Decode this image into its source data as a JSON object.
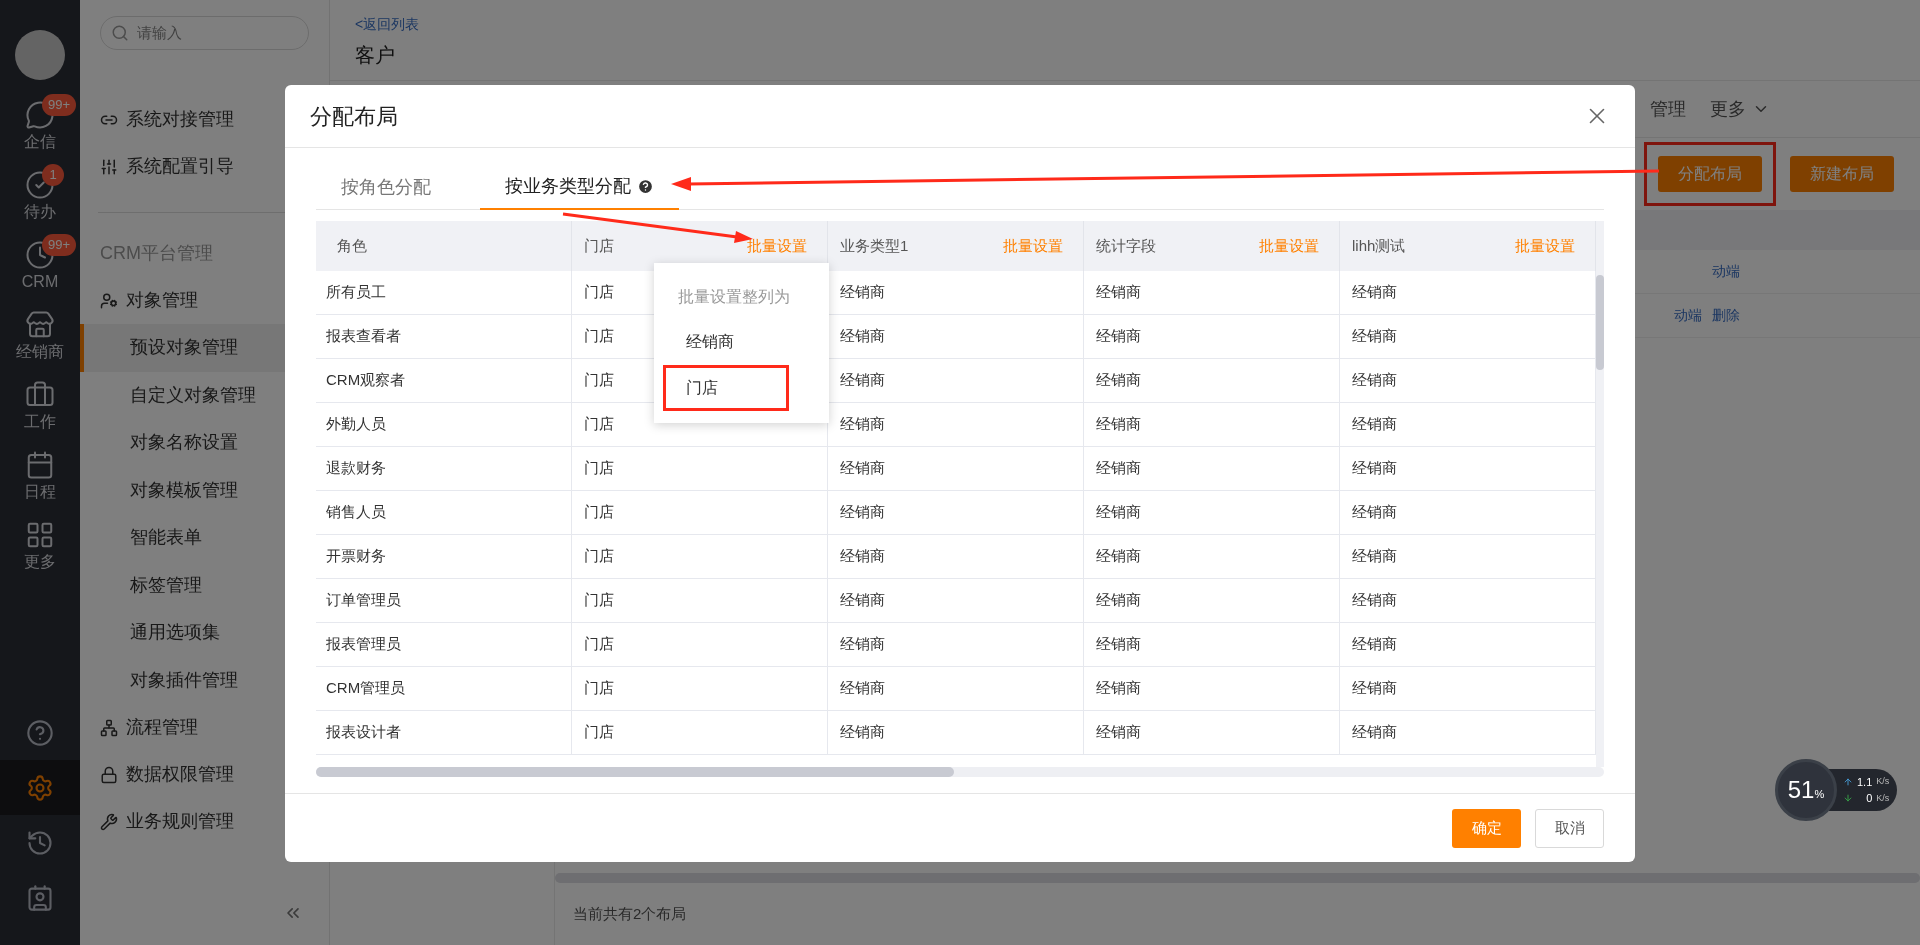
{
  "rail": {
    "items": [
      {
        "label": "企信",
        "badge": "99+"
      },
      {
        "label": "待办",
        "badge": "1"
      },
      {
        "label": "CRM",
        "badge": "99+"
      },
      {
        "label": "经销商"
      },
      {
        "label": "工作"
      },
      {
        "label": "日程"
      },
      {
        "label": "更多"
      }
    ],
    "bottom": [
      {
        "selected": false
      },
      {
        "selected": true
      },
      {
        "selected": false
      },
      {
        "selected": false
      }
    ]
  },
  "sidebar": {
    "search": {
      "placeholder": "请输入"
    },
    "top_items": [
      {
        "label": "系统对接管理"
      },
      {
        "label": "系统配置引导"
      }
    ],
    "section": "CRM平台管理",
    "groups": [
      {
        "label": "对象管理",
        "children": [
          {
            "label": "预设对象管理",
            "selected": true
          },
          {
            "label": "自定义对象管理",
            "selected": false
          },
          {
            "label": "对象名称设置",
            "selected": false
          },
          {
            "label": "对象模板管理",
            "selected": false
          },
          {
            "label": "智能表单",
            "selected": false
          },
          {
            "label": "标签管理",
            "selected": false
          },
          {
            "label": "通用选项集",
            "selected": false
          },
          {
            "label": "对象插件管理",
            "selected": false
          }
        ]
      },
      {
        "label": "流程管理"
      },
      {
        "label": "数据权限管理"
      },
      {
        "label": "业务规则管理"
      }
    ]
  },
  "page": {
    "back_link": "<返回列表",
    "title": "客户",
    "tabs": [
      {
        "label": "管理",
        "kind": "tab"
      },
      {
        "label": "更多",
        "kind": "menu"
      }
    ],
    "buttons": [
      {
        "label": "分配布局",
        "highlighted": true
      },
      {
        "label": "新建布局",
        "highlighted": false
      }
    ],
    "rows": [
      {
        "links": [
          "动端"
        ]
      },
      {
        "links": [
          "动端",
          "删除"
        ]
      }
    ],
    "summary": "当前共有2个布局"
  },
  "dialog": {
    "title": "分配布局",
    "tabs": [
      {
        "label": "按角色分配",
        "selected": false,
        "help": false
      },
      {
        "label": "按业务类型分配",
        "selected": true,
        "help": true
      }
    ],
    "columns": [
      {
        "label": "角色"
      },
      {
        "label": "门店",
        "action": "批量设置",
        "menu": {
          "title": "批量设置整列为",
          "options": [
            {
              "label": "经销商",
              "selected": false
            },
            {
              "label": "门店",
              "selected": true
            }
          ]
        }
      },
      {
        "label": "业务类型1",
        "action": "批量设置"
      },
      {
        "label": "统计字段",
        "action": "批量设置"
      },
      {
        "label": "lihh测试",
        "action": "批量设置"
      }
    ],
    "rows": [
      [
        "所有员工",
        "门店",
        "经销商",
        "经销商",
        "经销商"
      ],
      [
        "报表查看者",
        "门店",
        "经销商",
        "经销商",
        "经销商"
      ],
      [
        "CRM观察者",
        "门店",
        "经销商",
        "经销商",
        "经销商"
      ],
      [
        "外勤人员",
        "门店",
        "经销商",
        "经销商",
        "经销商"
      ],
      [
        "退款财务",
        "门店",
        "经销商",
        "经销商",
        "经销商"
      ],
      [
        "销售人员",
        "门店",
        "经销商",
        "经销商",
        "经销商"
      ],
      [
        "开票财务",
        "门店",
        "经销商",
        "经销商",
        "经销商"
      ],
      [
        "订单管理员",
        "门店",
        "经销商",
        "经销商",
        "经销商"
      ],
      [
        "报表管理员",
        "门店",
        "经销商",
        "经销商",
        "经销商"
      ],
      [
        "CRM管理员",
        "门店",
        "经销商",
        "经销商",
        "经销商"
      ],
      [
        "报表设计者",
        "门店",
        "经销商",
        "经销商",
        "经销商"
      ]
    ],
    "buttons": [
      {
        "label": "确定",
        "kind": "primary"
      },
      {
        "label": "取消",
        "kind": "secondary"
      }
    ]
  },
  "widget": {
    "percent": "51",
    "percent_sign": "%",
    "upload": {
      "value": "1.1",
      "unit": "K/s"
    },
    "download": {
      "value": "0",
      "unit": "K/s"
    }
  }
}
